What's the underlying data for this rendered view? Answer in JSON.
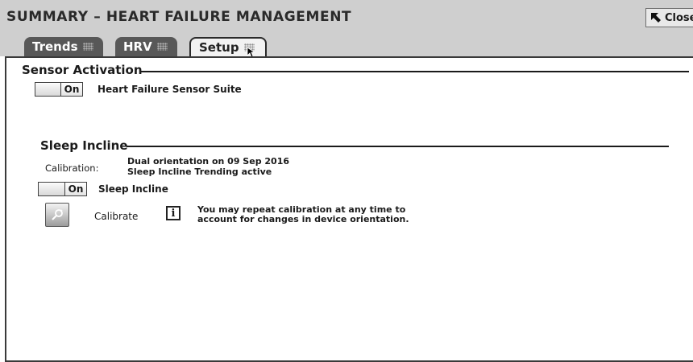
{
  "window": {
    "title": "SUMMARY – HEART FAILURE MANAGEMENT",
    "close_label": "Close"
  },
  "tabs": [
    {
      "label": "Trends",
      "active": false
    },
    {
      "label": "HRV",
      "active": false
    },
    {
      "label": "Setup",
      "active": true
    }
  ],
  "sensor_activation": {
    "heading": "Sensor Activation",
    "toggle_state": "On",
    "toggle_label": "Heart Failure Sensor Suite"
  },
  "sleep_incline": {
    "heading": "Sleep Incline",
    "calibration_label": "Calibration:",
    "calibration_line1": "Dual orientation on 09 Sep 2016",
    "calibration_line2": "Sleep Incline Trending active",
    "toggle_state": "On",
    "toggle_label": "Sleep Incline",
    "calibrate_label": "Calibrate",
    "info_glyph": "i",
    "info_line1": "You may repeat calibration at any time to",
    "info_line2": "account for changes in device orientation."
  },
  "colors": {
    "titlebar": "#cfcfcf",
    "tab_inactive": "#585858",
    "tab_active": "#f2f2f2",
    "text": "#1a1a1a"
  },
  "icons": {
    "close": "arrow-up-left-icon",
    "calibrate": "magnifier-wand-icon",
    "info": "info-icon",
    "cursor": "mouse-pointer-icon"
  }
}
